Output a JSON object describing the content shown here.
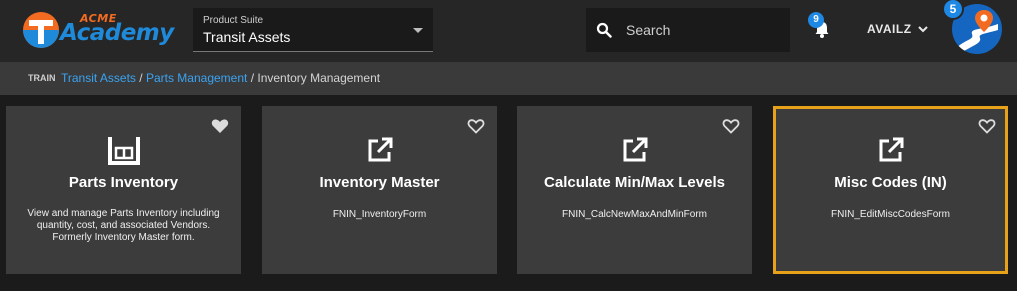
{
  "logo": {
    "acme": "ACME",
    "academy": "Academy"
  },
  "suite": {
    "label": "Product Suite",
    "value": "Transit Assets"
  },
  "search": {
    "placeholder": "Search"
  },
  "notifications": {
    "count": "9"
  },
  "user": {
    "name": "AVAILZ",
    "avatar_badge": "5"
  },
  "breadcrumb": {
    "env": "TRAIN",
    "items": [
      "Transit Assets",
      "Parts Management",
      "Inventory Management"
    ],
    "separator": "/"
  },
  "cards": [
    {
      "title": "Parts Inventory",
      "icon": "warehouse-icon",
      "favorited": true,
      "description": "View and manage Parts Inventory including quantity, cost, and associated Vendors. Formerly Inventory Master form."
    },
    {
      "title": "Inventory Master",
      "icon": "external-link-icon",
      "favorited": false,
      "subtitle": "FNIN_InventoryForm"
    },
    {
      "title": "Calculate Min/Max Levels",
      "icon": "external-link-icon",
      "favorited": false,
      "subtitle": "FNIN_CalcNewMaxAndMinForm"
    },
    {
      "title": "Misc Codes (IN)",
      "icon": "external-link-icon",
      "favorited": false,
      "subtitle": "FNIN_EditMiscCodesForm",
      "selected": true
    }
  ],
  "colors": {
    "accent": "#1e88e5",
    "selected_border": "#e8a21a",
    "link": "#3ba3f0",
    "brand_orange": "#f26b21"
  }
}
